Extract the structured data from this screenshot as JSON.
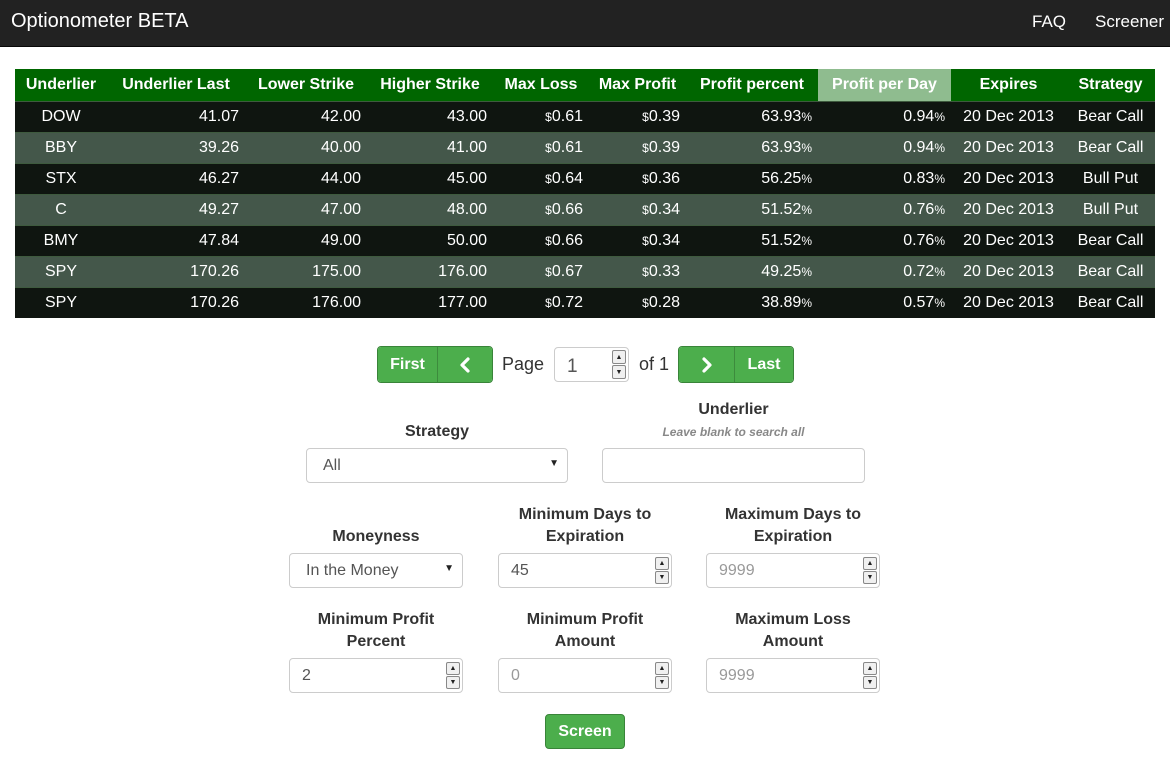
{
  "nav": {
    "brand": "Optionometer BETA",
    "faq": "FAQ",
    "screener": "Screener"
  },
  "table": {
    "headers": [
      "Underlier",
      "Underlier Last",
      "Lower Strike",
      "Higher Strike",
      "Max Loss",
      "Max Profit",
      "Profit percent",
      "Profit per Day",
      "Expires",
      "Strategy"
    ],
    "sorted_column": "Profit per Day",
    "currency_symbol": "$",
    "percent_symbol": "%",
    "rows": [
      {
        "underlier": "DOW",
        "last": "41.07",
        "lower": "42.00",
        "higher": "43.00",
        "max_loss": "0.61",
        "max_profit": "0.39",
        "profit_pct": "63.93",
        "profit_day": "0.94",
        "expires": "20 Dec 2013",
        "strategy": "Bear Call"
      },
      {
        "underlier": "BBY",
        "last": "39.26",
        "lower": "40.00",
        "higher": "41.00",
        "max_loss": "0.61",
        "max_profit": "0.39",
        "profit_pct": "63.93",
        "profit_day": "0.94",
        "expires": "20 Dec 2013",
        "strategy": "Bear Call"
      },
      {
        "underlier": "STX",
        "last": "46.27",
        "lower": "44.00",
        "higher": "45.00",
        "max_loss": "0.64",
        "max_profit": "0.36",
        "profit_pct": "56.25",
        "profit_day": "0.83",
        "expires": "20 Dec 2013",
        "strategy": "Bull Put"
      },
      {
        "underlier": "C",
        "last": "49.27",
        "lower": "47.00",
        "higher": "48.00",
        "max_loss": "0.66",
        "max_profit": "0.34",
        "profit_pct": "51.52",
        "profit_day": "0.76",
        "expires": "20 Dec 2013",
        "strategy": "Bull Put"
      },
      {
        "underlier": "BMY",
        "last": "47.84",
        "lower": "49.00",
        "higher": "50.00",
        "max_loss": "0.66",
        "max_profit": "0.34",
        "profit_pct": "51.52",
        "profit_day": "0.76",
        "expires": "20 Dec 2013",
        "strategy": "Bear Call"
      },
      {
        "underlier": "SPY",
        "last": "170.26",
        "lower": "175.00",
        "higher": "176.00",
        "max_loss": "0.67",
        "max_profit": "0.33",
        "profit_pct": "49.25",
        "profit_day": "0.72",
        "expires": "20 Dec 2013",
        "strategy": "Bear Call"
      },
      {
        "underlier": "SPY",
        "last": "170.26",
        "lower": "176.00",
        "higher": "177.00",
        "max_loss": "0.72",
        "max_profit": "0.28",
        "profit_pct": "38.89",
        "profit_day": "0.57",
        "expires": "20 Dec 2013",
        "strategy": "Bear Call"
      }
    ]
  },
  "pagination": {
    "first": "First",
    "prev_icon": "chevron-left-icon",
    "page_label": "Page",
    "page_value": "1",
    "of_label": "of 1",
    "next_icon": "chevron-right-icon",
    "last": "Last"
  },
  "form": {
    "strategy": {
      "label": "Strategy",
      "value": "All"
    },
    "underlier": {
      "label": "Underlier",
      "hint": "Leave blank to search all",
      "value": ""
    },
    "moneyness": {
      "label": "Moneyness",
      "value": "In the Money"
    },
    "min_days": {
      "label_line1": "Minimum Days to",
      "label_line2": "Expiration",
      "value": "45"
    },
    "max_days": {
      "label_line1": "Maximum Days to",
      "label_line2": "Expiration",
      "placeholder": "9999"
    },
    "min_profit_pct": {
      "label_line1": "Minimum Profit",
      "label_line2": "Percent",
      "value": "2"
    },
    "min_profit_amt": {
      "label_line1": "Minimum Profit",
      "label_line2": "Amount",
      "placeholder": "0"
    },
    "max_loss_amt": {
      "label_line1": "Maximum Loss",
      "label_line2": "Amount",
      "placeholder": "9999"
    },
    "screen_button": "Screen"
  },
  "colors": {
    "header_green": "#006600",
    "sorted_header": "#8fbc8f",
    "row_dark": "#0f1510",
    "row_light": "#44574a",
    "button_green": "#4cae4c",
    "navbar": "#222222"
  }
}
